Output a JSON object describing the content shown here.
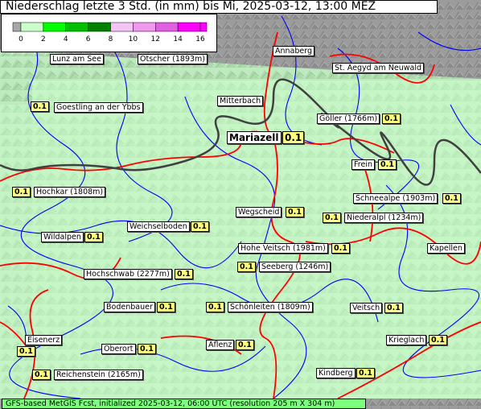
{
  "title": "Niederschlag letzte 3 Std. (in mm) bis Mi, 2025-03-12, 13:00 MEZ",
  "legend": {
    "ticks": [
      "0",
      "2",
      "4",
      "6",
      "8",
      "10",
      "12",
      "14",
      "16"
    ],
    "colors": [
      "#a8a8a8",
      "#caffca",
      "#00ff00",
      "#00c000",
      "#008000",
      "#f4c4f4",
      "#ee99ee",
      "#e060e0",
      "#ff00ff"
    ]
  },
  "colors": {
    "river": "#0000ff",
    "road": "#ff0000",
    "border": "#404040",
    "low_precip": "#ccffcc",
    "mountain": "#9a9a9a"
  },
  "places": [
    {
      "name": "Lunz am See"
    },
    {
      "name": "Ötscher (1893m)"
    },
    {
      "name": "Annaberg"
    },
    {
      "name": "St. Aegyd am Neuwald"
    },
    {
      "name": "Goestling an der Ybbs",
      "value": "0.1"
    },
    {
      "name": "Mitterbach"
    },
    {
      "name": "Göller (1766m)",
      "value": "0.1"
    },
    {
      "name": "Mariazell",
      "value": "0.1"
    },
    {
      "name": "Frein",
      "value": "0.1"
    },
    {
      "name": "Hochkar (1808m)",
      "value": "0.1"
    },
    {
      "name": "Schneealpe (1903m)",
      "value": "0.1"
    },
    {
      "name": "Wegscheid",
      "value": "0.1"
    },
    {
      "name": "Niederalpl (1234m)",
      "value": "0.1"
    },
    {
      "name": "Weichselboden",
      "value": "0.1"
    },
    {
      "name": "Wildalpen",
      "value": "0.1"
    },
    {
      "name": "Hohe Veitsch (1981m)",
      "value": "0.1"
    },
    {
      "name": "Kapellen"
    },
    {
      "name": "Seeberg (1246m)",
      "value": "0.1"
    },
    {
      "name": "Hochschwab (2277m)",
      "value": "0.1"
    },
    {
      "name": "Bodenbauer",
      "value": "0.1"
    },
    {
      "name": "Schönleiten (1809m)",
      "value": "0.1"
    },
    {
      "name": "Veitsch",
      "value": "0.1"
    },
    {
      "name": "Eisenerz",
      "value": "0.1"
    },
    {
      "name": "Oberort",
      "value": "0.1"
    },
    {
      "name": "Aflenz",
      "value": "0.1"
    },
    {
      "name": "Krieglach",
      "value": "0.1"
    },
    {
      "name": "Reichenstein (2165m)",
      "value": "0.1"
    },
    {
      "name": "Kindberg",
      "value": "0.1"
    }
  ],
  "footer": "GFS-based MetGIS Fcst, initialized 2025-03-12, 06:00 UTC  (resolution 205 m X 304 m)"
}
